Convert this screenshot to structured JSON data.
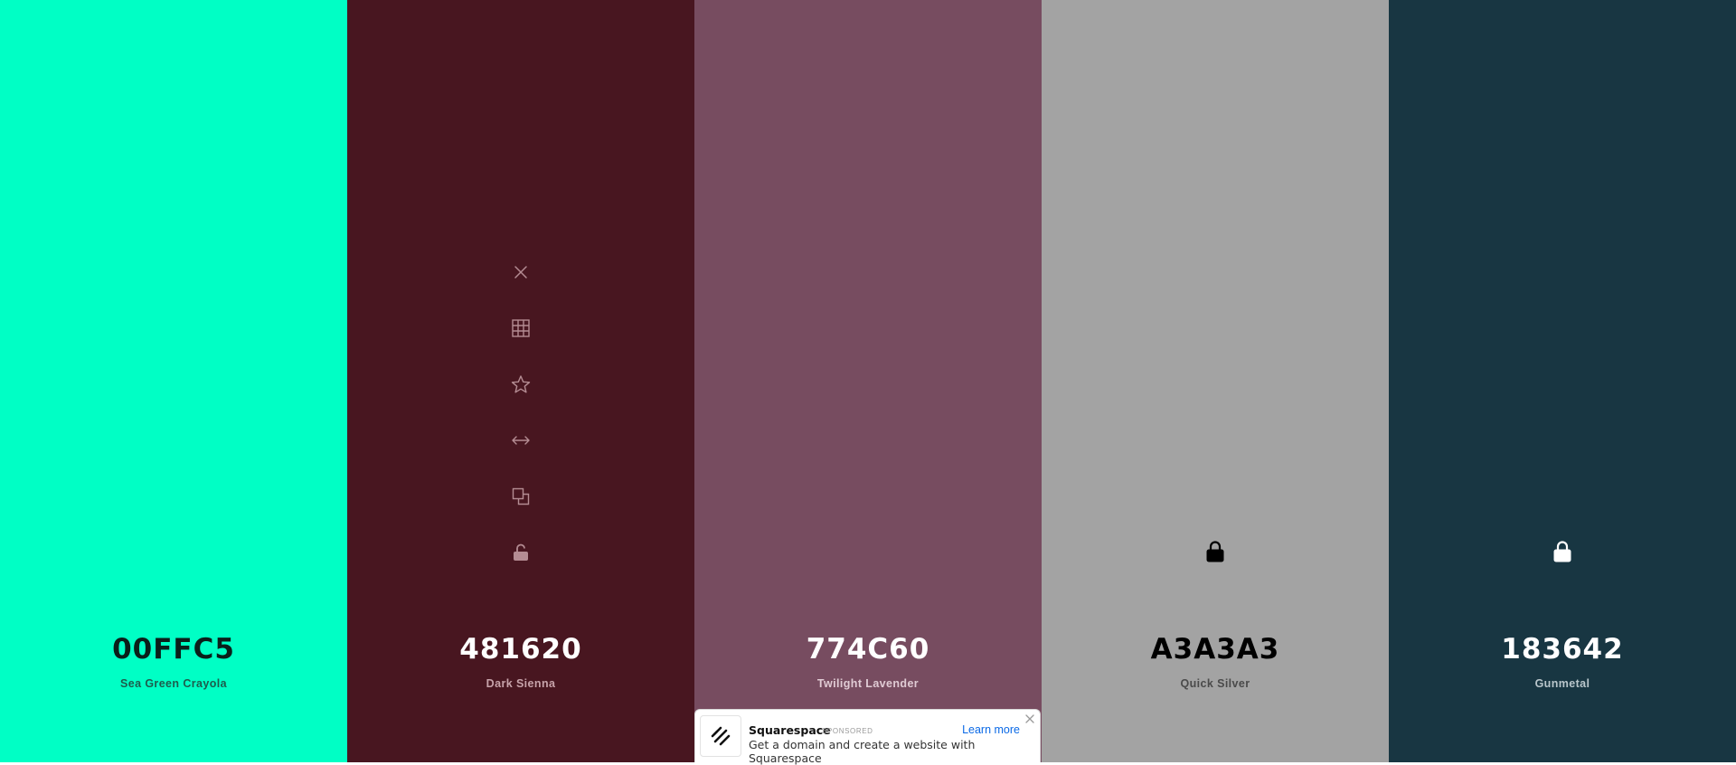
{
  "swatches": [
    {
      "hex": "00FFC5",
      "name": "Sea Green Crayola",
      "bg": "#00FFC5",
      "hex_color": "#0b1f1a",
      "name_color": "#1d5c4c"
    },
    {
      "hex": "481620",
      "name": "Dark Sienna",
      "bg": "#481620",
      "hex_color": "#ffffff",
      "name_color": "#c7a3aa"
    },
    {
      "hex": "774C60",
      "name": "Twilight Lavender",
      "bg": "#774C60",
      "hex_color": "#ffffff",
      "name_color": "#e0cbd4"
    },
    {
      "hex": "A3A3A3",
      "name": "Quick Silver",
      "bg": "#A3A3A3",
      "hex_color": "#000000",
      "name_color": "#4a4a4a"
    },
    {
      "hex": "183642",
      "name": "Gunmetal",
      "bg": "#183642",
      "hex_color": "#ffffff",
      "name_color": "#b9c6cb"
    }
  ],
  "toolbar_icons": [
    "close-icon",
    "grid-icon",
    "star-icon",
    "drag-arrows-icon",
    "copy-icon",
    "unlock-icon"
  ],
  "locked_icon": "lock-icon",
  "ad": {
    "brand": "Squarespace",
    "sponsored": "SPONSORED",
    "learn_more": "Learn more",
    "text": "Get a domain and create a website with Squarespace",
    "logo_icon": "squarespace-logo-icon",
    "close_icon": "close-icon"
  }
}
